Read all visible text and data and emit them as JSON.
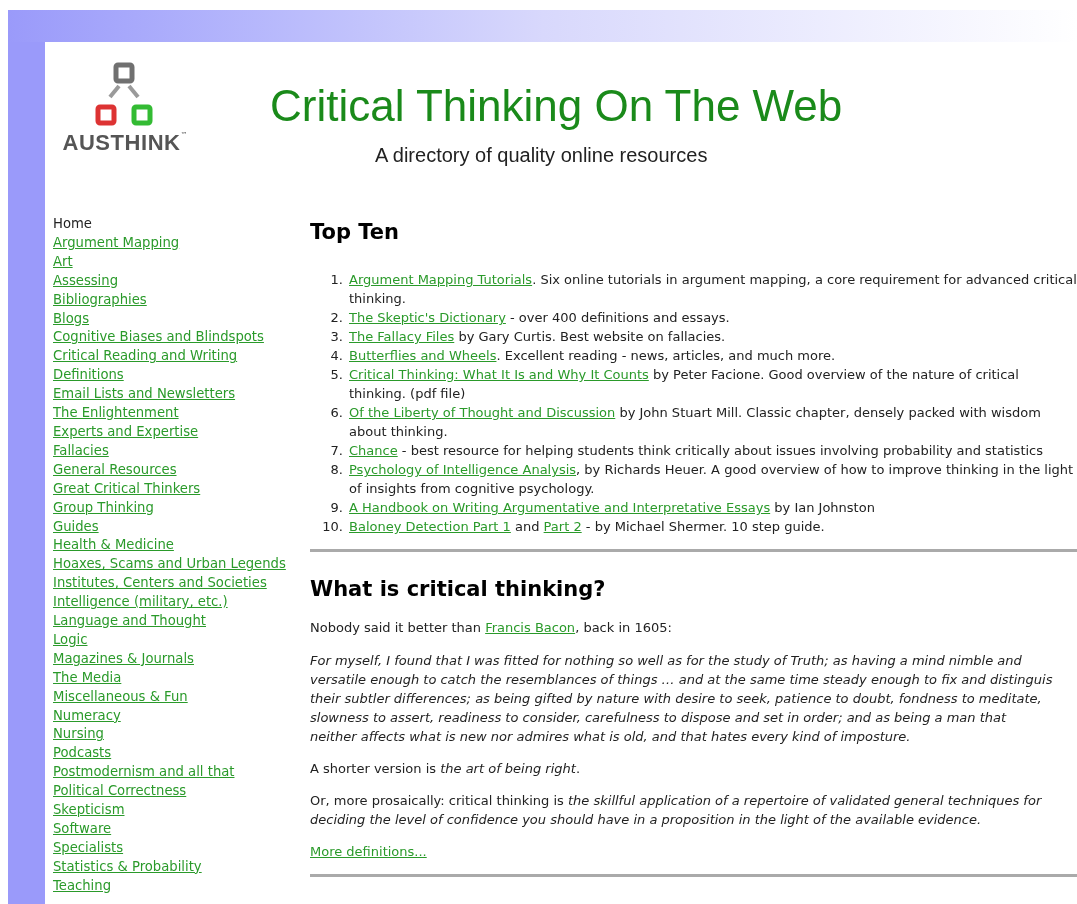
{
  "logo": {
    "name": "AUSTHINK",
    "mark": "™"
  },
  "header": {
    "title": "Critical Thinking On The Web",
    "subtitle": "A directory of quality online resources"
  },
  "sidebar": {
    "items": [
      {
        "label": "Home",
        "selected": true
      },
      {
        "label": "Argument Mapping",
        "selected": false
      },
      {
        "label": "Art",
        "selected": false
      },
      {
        "label": "Assessing",
        "selected": false
      },
      {
        "label": "Bibliographies",
        "selected": false
      },
      {
        "label": "Blogs",
        "selected": false
      },
      {
        "label": "Cognitive Biases and Blindspots",
        "selected": false
      },
      {
        "label": "Critical Reading and Writing",
        "selected": false
      },
      {
        "label": "Definitions",
        "selected": false
      },
      {
        "label": "Email Lists and Newsletters",
        "selected": false
      },
      {
        "label": "The Enlightenment",
        "selected": false
      },
      {
        "label": "Experts and Expertise",
        "selected": false
      },
      {
        "label": "Fallacies",
        "selected": false
      },
      {
        "label": "General Resources",
        "selected": false
      },
      {
        "label": "Great Critical Thinkers",
        "selected": false
      },
      {
        "label": "Group Thinking",
        "selected": false
      },
      {
        "label": "Guides",
        "selected": false
      },
      {
        "label": "Health & Medicine",
        "selected": false
      },
      {
        "label": "Hoaxes, Scams and Urban Legends",
        "selected": false
      },
      {
        "label": "Institutes, Centers and Societies",
        "selected": false
      },
      {
        "label": "Intelligence (military, etc.)",
        "selected": false
      },
      {
        "label": "Language and Thought",
        "selected": false
      },
      {
        "label": "Logic",
        "selected": false
      },
      {
        "label": "Magazines & Journals",
        "selected": false
      },
      {
        "label": "The Media",
        "selected": false
      },
      {
        "label": "Miscellaneous & Fun",
        "selected": false
      },
      {
        "label": "Numeracy",
        "selected": false
      },
      {
        "label": "Nursing",
        "selected": false
      },
      {
        "label": "Podcasts",
        "selected": false
      },
      {
        "label": "Postmodernism and all that",
        "selected": false
      },
      {
        "label": "Political Correctness",
        "selected": false
      },
      {
        "label": "Skepticism",
        "selected": false
      },
      {
        "label": "Software",
        "selected": false
      },
      {
        "label": "Specialists",
        "selected": false
      },
      {
        "label": "Statistics & Probability",
        "selected": false
      },
      {
        "label": "Teaching",
        "selected": false
      }
    ]
  },
  "top_ten": {
    "heading": "Top Ten",
    "items": [
      {
        "number": "1.",
        "parts": [
          {
            "kind": "link",
            "text": "Argument Mapping Tutorials"
          },
          {
            "kind": "text",
            "text": ".  Six online tutorials in argument mapping, a core requirement for advanced critical thinking."
          }
        ]
      },
      {
        "number": "2.",
        "parts": [
          {
            "kind": "link",
            "text": "The Skeptic's Dictionary"
          },
          {
            "kind": "text",
            "text": " - over 400 definitions and essays."
          }
        ]
      },
      {
        "number": "3.",
        "parts": [
          {
            "kind": "link",
            "text": "The Fallacy Files"
          },
          {
            "kind": "text",
            "text": " by Gary Curtis. Best website on fallacies."
          }
        ]
      },
      {
        "number": "4.",
        "parts": [
          {
            "kind": "link",
            "text": "Butterflies and Wheels"
          },
          {
            "kind": "text",
            "text": ". Excellent reading - news, articles, and much more."
          }
        ]
      },
      {
        "number": "5.",
        "parts": [
          {
            "kind": "link",
            "text": "Critical Thinking: What It Is and Why It Counts"
          },
          {
            "kind": "text",
            "text": " by Peter Facione. Good overview of the nature of critical thinking. (pdf file)"
          }
        ]
      },
      {
        "number": "6.",
        "parts": [
          {
            "kind": "link",
            "text": "Of the Liberty of Thought and Discussion"
          },
          {
            "kind": "text",
            "text": " by John Stuart Mill. Classic chapter, densely packed with wisdom about thinking."
          }
        ]
      },
      {
        "number": "7.",
        "parts": [
          {
            "kind": "link",
            "text": "Chance"
          },
          {
            "kind": "text",
            "text": " - best resource for helping students think critically about issues involving probability and statistics"
          }
        ]
      },
      {
        "number": "8.",
        "parts": [
          {
            "kind": "link",
            "text": "Psychology of Intelligence Analysis"
          },
          {
            "kind": "text",
            "text": ", by Richards Heuer. A good overview of how to improve thinking in the light of insights from cognitive psychology."
          }
        ]
      },
      {
        "number": "9.",
        "parts": [
          {
            "kind": "link",
            "text": "A Handbook on Writing Argumentative and Interpretative Essays"
          },
          {
            "kind": "text",
            "text": " by Ian Johnston"
          }
        ]
      },
      {
        "number": "10.",
        "parts": [
          {
            "kind": "link",
            "text": "Baloney Detection Part 1"
          },
          {
            "kind": "text",
            "text": " and "
          },
          {
            "kind": "link",
            "text": "Part 2"
          },
          {
            "kind": "text",
            "text": " - by Michael Shermer. 10 step guide."
          }
        ]
      }
    ]
  },
  "definition": {
    "heading": "What is critical thinking?",
    "intro": [
      {
        "kind": "text",
        "text": "Nobody said it better than "
      },
      {
        "kind": "link",
        "text": "Francis Bacon"
      },
      {
        "kind": "text",
        "text": ", back in 1605:"
      }
    ],
    "quote_lines": [
      "For myself, I found that I was fitted for nothing so well as for the study of Truth; as having a mind nimble and",
      "versatile enough to catch the resemblances of things … and at the same time steady enough to fix and distinguis",
      "their subtler differences; as being gifted by nature with desire to seek, patience to doubt, fondness to meditate,",
      "slowness to assert, readiness to consider, carefulness to dispose and set in order; and as being a man that",
      "neither affects what is new nor admires what is old, and that hates every kind of imposture."
    ],
    "shorter": "A shorter version is *the art of being right*.",
    "prosaic": "Or, more prosaically: critical thinking is *the skillful application of a repertoire of validated general techniques for deciding the level of confidence you should have in a proposition in the light of the available evidence.*",
    "more_link": "More definitions..."
  }
}
